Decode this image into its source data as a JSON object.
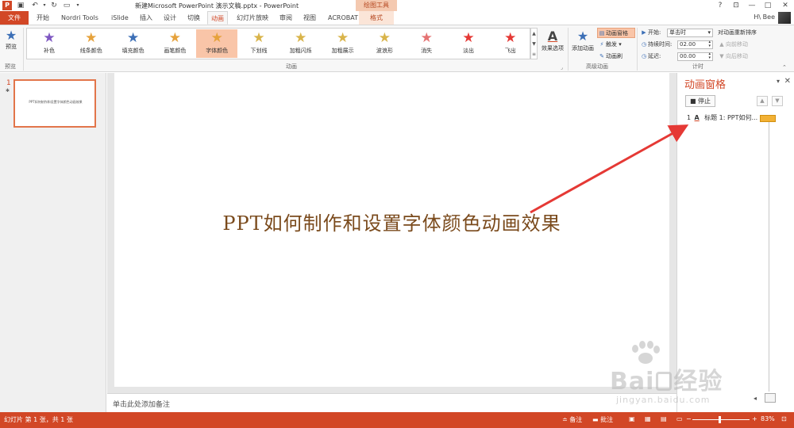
{
  "window": {
    "doc_title": "新建Microsoft PowerPoint 演示文稿.pptx - PowerPoint",
    "context_tool": "绘图工具",
    "user": "H\\ Bee",
    "help": "?",
    "minimize": "—",
    "restore": "□",
    "close": "✕"
  },
  "tabs": {
    "file": "文件",
    "items": [
      "开始",
      "Nordri Tools",
      "iSlide",
      "插入",
      "设计",
      "切换",
      "动画",
      "幻灯片放映",
      "审阅",
      "视图",
      "ACROBAT",
      "格式"
    ],
    "active": "动画"
  },
  "ribbon": {
    "preview_label": "预览",
    "preview_group": "预览",
    "animation_group": "动画",
    "advanced_group": "高级动画",
    "timing_group": "计时",
    "gallery": [
      {
        "label": "补色",
        "color": "#7e57c2"
      },
      {
        "label": "线条颜色",
        "color": "#e6a23c"
      },
      {
        "label": "填充颜色",
        "color": "#3c6fb6"
      },
      {
        "label": "画笔颜色",
        "color": "#e6a23c"
      },
      {
        "label": "字体颜色",
        "color": "#e6a23c"
      },
      {
        "label": "下划线",
        "color": "#d9b44a"
      },
      {
        "label": "加粗闪烁",
        "color": "#d9b44a"
      },
      {
        "label": "加粗展示",
        "color": "#d9b44a"
      },
      {
        "label": "波浪形",
        "color": "#d9b44a"
      },
      {
        "label": "消失",
        "color": "#e57373"
      },
      {
        "label": "淡出",
        "color": "#e53935"
      },
      {
        "label": "飞出",
        "color": "#e53935"
      }
    ],
    "selected_effect": "字体颜色",
    "effect_options": "效果选项",
    "add_animation": "添加动画",
    "animation_pane": "动画窗格",
    "trigger": "触发",
    "animation_painter": "动画刷",
    "start_label": "开始:",
    "start_value": "单击时",
    "duration_label": "持续时间:",
    "duration_value": "02.00",
    "delay_label": "延迟:",
    "delay_value": "00.00",
    "reorder_title": "对动画重新排序",
    "move_earlier": "向前移动",
    "move_later": "向后移动"
  },
  "thumbnails": {
    "slide_number": "1",
    "slide_marker": "✱",
    "thumb_text": "PPT如何制作和设置字体颜色动画效果"
  },
  "slide": {
    "title": "PPT如何制作和设置字体颜色动画效果"
  },
  "notes": {
    "placeholder": "单击此处添加备注"
  },
  "anim_pane": {
    "title": "动画窗格",
    "stop_label": "停止",
    "item_number": "1",
    "item_label": "标题 1: PPT如何...",
    "timeline_label": "0"
  },
  "status": {
    "slide_info": "幻灯片 第 1 张，共 1 张",
    "notes_btn": "备注",
    "comments_btn": "批注",
    "zoom": "83%"
  },
  "watermark": {
    "brand": "Bai",
    "brand_tail": "经验",
    "url": "jingyan.baidu.com"
  },
  "colors": {
    "accent": "#d24726",
    "selected_fill": "#f9c5a8",
    "slide_title": "#7a4a1c",
    "timing_bar": "#f2b134",
    "arrow": "#e53935"
  }
}
